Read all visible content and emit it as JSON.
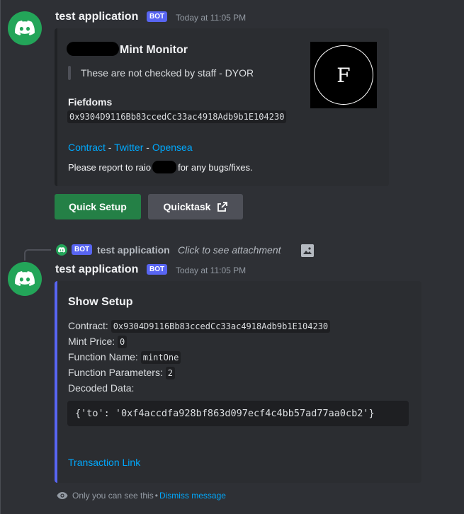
{
  "message1": {
    "username": "test application",
    "bot_tag": "BOT",
    "timestamp": "Today at 11:05 PM",
    "embed": {
      "title": "Mint Monitor",
      "quote": "These are not checked by staff - DYOR",
      "field_name": "Fiefdoms",
      "field_value": "0x9304D9116Bb83ccedCc33ac4918Adb9b1E104230",
      "links": [
        "Contract",
        "Twitter",
        "Opensea"
      ],
      "link_sep": " - ",
      "footer_prefix": "Please report to raio",
      "footer_suffix": "for any bugs/fixes.",
      "thumbnail_letter": "F"
    },
    "buttons": {
      "quick_setup": "Quick Setup",
      "quicktask": "Quicktask"
    }
  },
  "reply": {
    "bot_tag": "BOT",
    "username": "test application",
    "hint": "Click to see attachment"
  },
  "message2": {
    "username": "test application",
    "bot_tag": "BOT",
    "timestamp": "Today at 11:05 PM",
    "embed": {
      "title": "Show Setup",
      "contract_label": "Contract:",
      "contract_value": "0x9304D9116Bb83ccedCc33ac4918Adb9b1E104230",
      "mint_price_label": "Mint Price:",
      "mint_price_value": "0",
      "function_name_label": "Function Name:",
      "function_name_value": "mintOne",
      "function_params_label": "Function Parameters:",
      "function_params_value": "2",
      "decoded_label": "Decoded Data:",
      "decoded_value": "{'to': '0xf4accdfa928bf863d097ecf4c4bb57ad77aa0cb2'}",
      "transaction_link": "Transaction Link"
    },
    "ephemeral": {
      "notice": "Only you can see this",
      "sep": "•",
      "dismiss": "Dismiss message"
    }
  },
  "colors": {
    "accent_green": "#23a559",
    "blurple": "#5865f2",
    "link": "#00a8fc"
  },
  "icons": [
    "discord-logo-icon",
    "external-link-icon",
    "image-icon",
    "eye-icon"
  ]
}
